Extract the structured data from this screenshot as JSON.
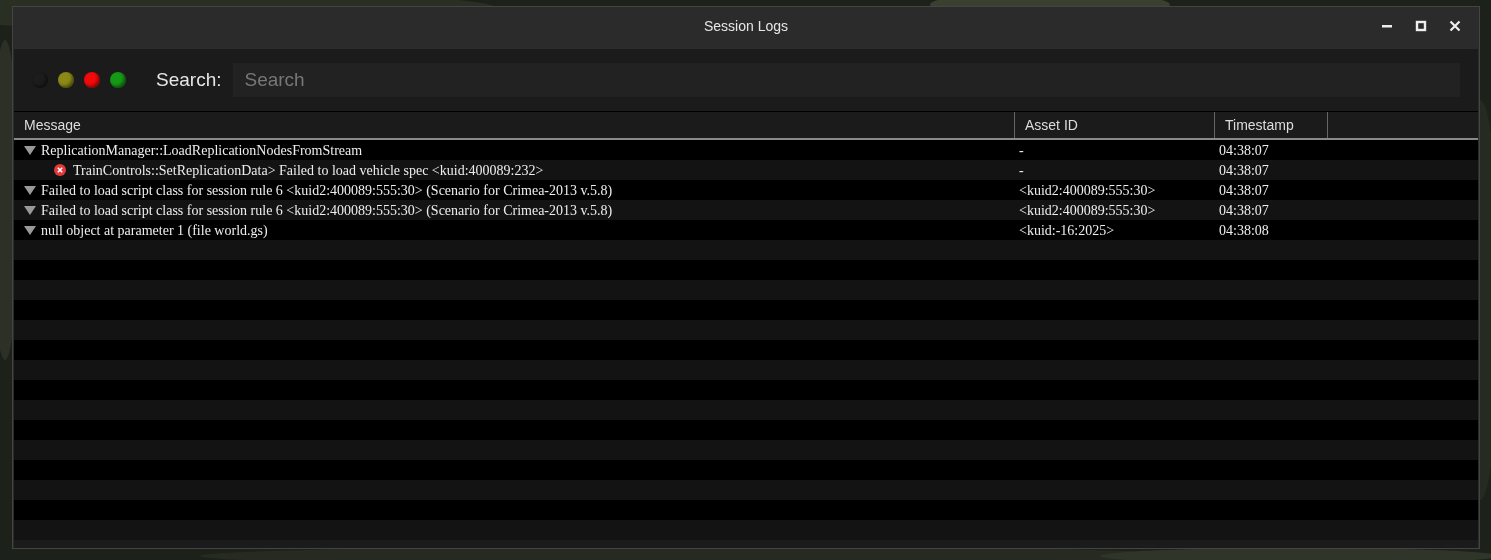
{
  "window": {
    "title": "Session Logs",
    "controls": [
      {
        "kind": "minimize"
      },
      {
        "kind": "maximize"
      },
      {
        "kind": "close"
      }
    ]
  },
  "filters": [
    {
      "color": "#1c1c1c"
    },
    {
      "color": "#8c8a16"
    },
    {
      "color": "#f20a0a"
    },
    {
      "color": "#169a16"
    }
  ],
  "search": {
    "label": "Search:",
    "placeholder": "Search"
  },
  "table": {
    "columns": [
      "Message",
      "Asset ID",
      "Timestamp"
    ],
    "rows": [
      {
        "kind": "group",
        "expanded": true,
        "message": "ReplicationManager::LoadReplicationNodesFromStream",
        "asset_id": "-",
        "timestamp": "04:38:07",
        "children": [
          {
            "kind": "error",
            "message": "TrainControls::SetReplicationData> Failed to load vehicle spec <kuid:400089:232>",
            "asset_id": "-",
            "timestamp": "04:38:07"
          }
        ]
      },
      {
        "kind": "group",
        "expanded": true,
        "message": "Failed to load script class for session rule 6 <kuid2:400089:555:30> (Scenario for Crimea-2013 v.5.8)",
        "asset_id": "<kuid2:400089:555:30>",
        "timestamp": "04:38:07"
      },
      {
        "kind": "group",
        "expanded": true,
        "message": "Failed to load script class for session rule 6 <kuid2:400089:555:30> (Scenario for Crimea-2013 v.5.8)",
        "asset_id": "<kuid2:400089:555:30>",
        "timestamp": "04:38:07"
      },
      {
        "kind": "group",
        "expanded": true,
        "message": "null object at parameter 1 (file world.gs)",
        "asset_id": "<kuid:-16:2025>",
        "timestamp": "04:38:08"
      }
    ]
  }
}
